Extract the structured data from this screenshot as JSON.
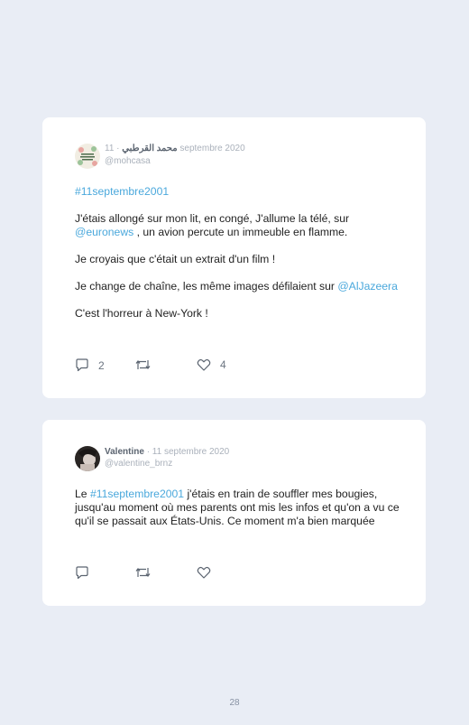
{
  "tweets": [
    {
      "name": "محمد القرطبي",
      "date": "· 11 septembre 2020",
      "handle": "@mohcasa",
      "hashtag": "#11septembre2001",
      "p2_before": "J'étais allongé sur mon lit, en congé, J'allume la télé, sur ",
      "p2_mention": "@euronews",
      "p2_after": " , un avion percute un immeuble en flamme.",
      "p3": "Je croyais que c'était un extrait d'un film !",
      "p4_before": "Je change de chaîne, les même images défilaient sur ",
      "p4_mention": "@AlJazeera",
      "p5": "C'est l'horreur à New-York !",
      "replies": "2",
      "likes": "4"
    },
    {
      "name": "Valentine",
      "date": "· 11 septembre 2020",
      "handle": "@valentine_brnz",
      "text_before": "Le ",
      "hashtag": "#11septembre2001",
      "text_after": " j'étais en train de souffler mes bougies, jusqu'au moment où mes parents ont mis les infos et qu'on a vu ce qu'il se passait aux États-Unis. Ce moment m'a bien marquée"
    }
  ],
  "page_number": "28",
  "colors": {
    "background": "#e9edf5",
    "link": "#4aa8dc",
    "card": "#ffffff"
  },
  "icons": [
    "reply-icon",
    "retweet-icon",
    "like-icon"
  ]
}
